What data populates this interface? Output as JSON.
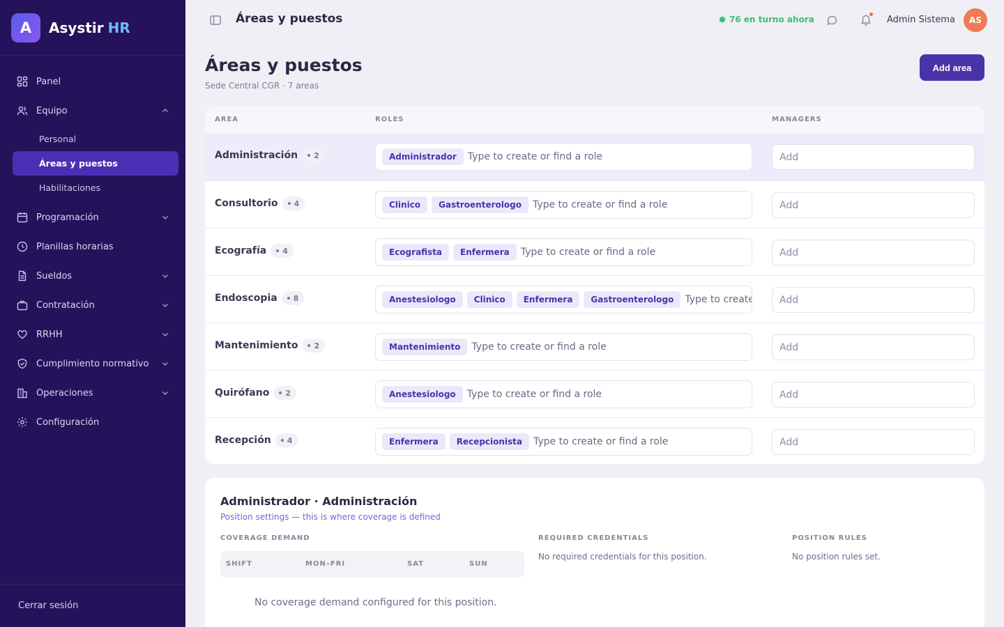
{
  "brand": {
    "logo_letter": "A",
    "name": "Asystir",
    "suffix": "HR"
  },
  "sidebar": {
    "items": [
      {
        "label": "Panel",
        "icon": "grid-icon",
        "chevron": false
      },
      {
        "label": "Equipo",
        "icon": "users-icon",
        "chevron": "up",
        "children": [
          {
            "label": "Personal",
            "active": false
          },
          {
            "label": "Áreas y puestos",
            "active": true
          },
          {
            "label": "Habilitaciones",
            "active": false
          }
        ]
      },
      {
        "label": "Programación",
        "icon": "calendar-icon",
        "chevron": "down"
      },
      {
        "label": "Planillas horarias",
        "icon": "clock-icon",
        "chevron": false
      },
      {
        "label": "Sueldos",
        "icon": "document-icon",
        "chevron": "down"
      },
      {
        "label": "Contratación",
        "icon": "briefcase-icon",
        "chevron": "down"
      },
      {
        "label": "RRHH",
        "icon": "heart-icon",
        "chevron": "down"
      },
      {
        "label": "Cumplimiento normativo",
        "icon": "shield-icon",
        "chevron": "down"
      },
      {
        "label": "Operaciones",
        "icon": "building-icon",
        "chevron": "down"
      },
      {
        "label": "Configuración",
        "icon": "gear-icon",
        "chevron": false
      }
    ],
    "logout": "Cerrar sesión"
  },
  "topbar": {
    "title": "Áreas y puestos",
    "on_shift": "76 en turno ahora",
    "user_name": "Admin Sistema",
    "avatar_initials": "AS"
  },
  "page": {
    "title": "Áreas y puestos",
    "subtitle": "Sede Central CGR · 7 areas",
    "add_area_label": "Add area"
  },
  "table": {
    "headers": {
      "area": "AREA",
      "roles": "ROLES",
      "managers": "MANAGERS"
    },
    "role_placeholder": "Type to create or find a role",
    "manager_placeholder": "Add",
    "rows": [
      {
        "area": "Administración",
        "count": "2",
        "roles": [
          "Administrador"
        ],
        "selected": true
      },
      {
        "area": "Consultorio",
        "count": "4",
        "roles": [
          "Clinico",
          "Gastroenterologo"
        ]
      },
      {
        "area": "Ecografía",
        "count": "4",
        "roles": [
          "Ecografista",
          "Enfermera"
        ]
      },
      {
        "area": "Endoscopia",
        "count": "8",
        "roles": [
          "Anestesiologo",
          "Clinico",
          "Enfermera",
          "Gastroenterologo"
        ]
      },
      {
        "area": "Mantenimiento",
        "count": "2",
        "roles": [
          "Mantenimiento"
        ]
      },
      {
        "area": "Quirófano",
        "count": "2",
        "roles": [
          "Anestesiologo"
        ]
      },
      {
        "area": "Recepción",
        "count": "4",
        "roles": [
          "Enfermera",
          "Recepcionista"
        ]
      }
    ]
  },
  "detail": {
    "title": "Administrador · Administración",
    "subtitle": "Position settings — this is where coverage is defined",
    "coverage_label": "COVERAGE DEMAND",
    "coverage_headers": [
      "SHIFT",
      "MON–FRI",
      "SAT",
      "SUN"
    ],
    "coverage_empty": "No coverage demand configured for this position.",
    "credentials_label": "REQUIRED CREDENTIALS",
    "credentials_text": "No required credentials for this position.",
    "rules_label": "POSITION RULES",
    "rules_text": "No position rules set."
  },
  "colors": {
    "sidebar_bg": "#24125a",
    "accent": "#4a33a8",
    "active_item": "#4a2fb4",
    "success": "#3bbf7a",
    "avatar": "#f07b56"
  }
}
